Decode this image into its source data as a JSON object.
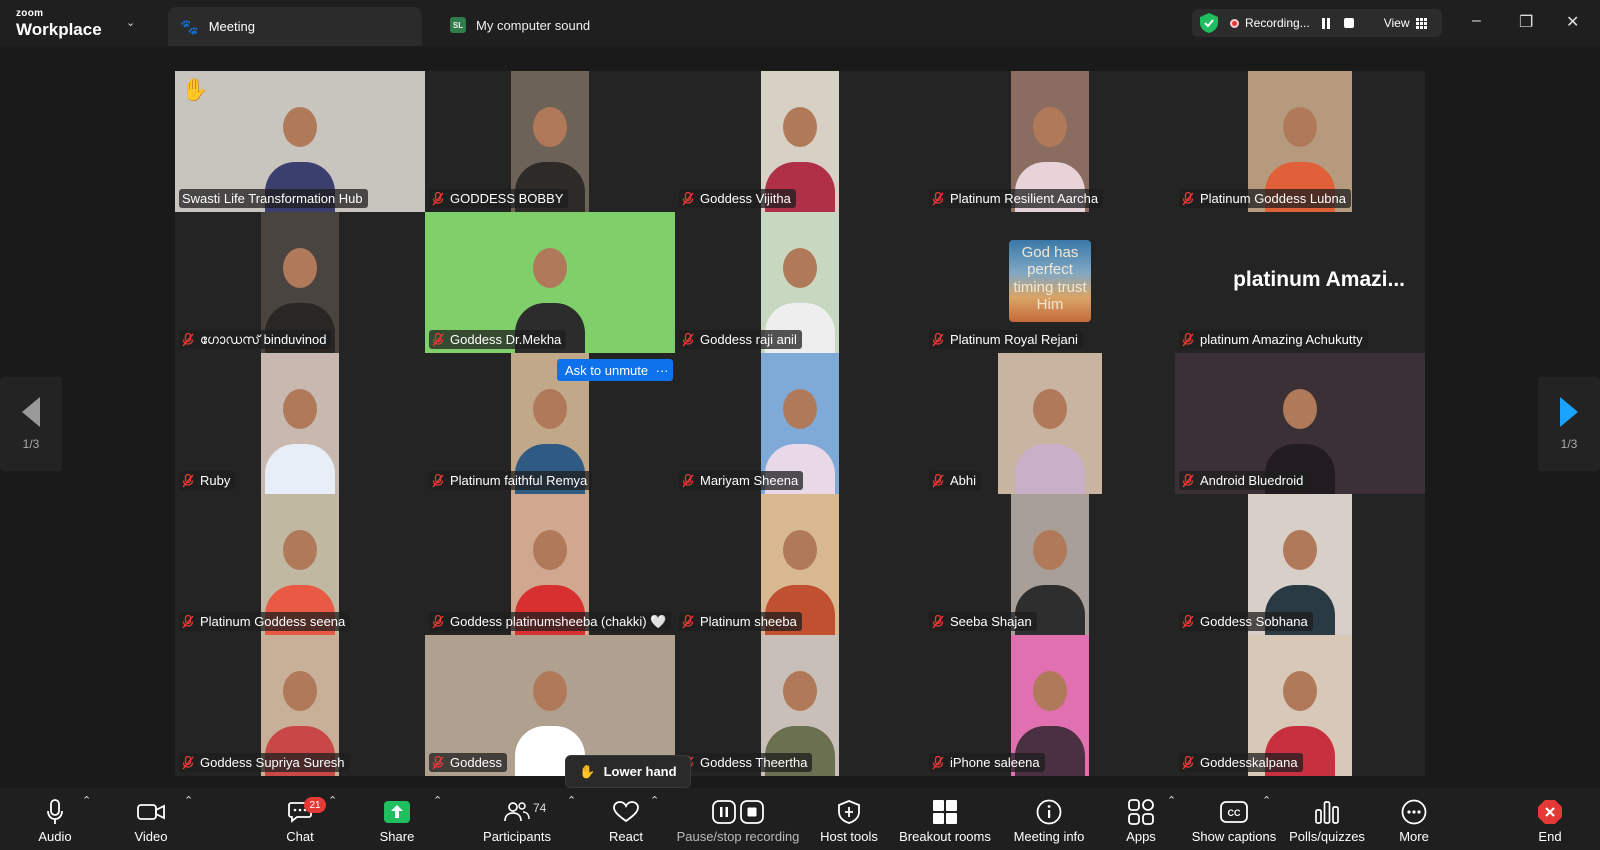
{
  "titlebar": {
    "brand_small": "zoom",
    "brand_large": "Workplace",
    "tab_meeting": "Meeting",
    "tab_sound_badge": "SL",
    "tab_sound": "My computer sound",
    "recording_label": "Recording...",
    "view_label": "View"
  },
  "overlay": {
    "ask_unmute": "Ask to unmute",
    "more": "···",
    "lower_hand": "Lower hand",
    "page_left": "1/3",
    "page_right": "1/3"
  },
  "participants": [
    {
      "name": "Swasti Life Transformation Hub",
      "muted": false,
      "active": true,
      "hand": true
    },
    {
      "name": "GODDESS BOBBY",
      "muted": true
    },
    {
      "name": "Goddess Vijitha",
      "muted": true
    },
    {
      "name": "Platinum Resilient Aarcha",
      "muted": true
    },
    {
      "name": "Platinum Goddess Lubna",
      "muted": true
    },
    {
      "name": "ഗോഡസ് binduvinod",
      "muted": true
    },
    {
      "name": "Goddess Dr.Mekha",
      "muted": true
    },
    {
      "name": "Goddess raji anil",
      "muted": true
    },
    {
      "name": "Platinum Royal Rejani",
      "muted": true,
      "image_text": "God has perfect timing trust Him"
    },
    {
      "name": "platinum Amazing Achukutty",
      "muted": true,
      "avatar_text": "platinum  Amazi..."
    },
    {
      "name": "Ruby",
      "muted": true
    },
    {
      "name": "Platinum faithful Remya",
      "muted": true
    },
    {
      "name": "Mariyam Sheena",
      "muted": true
    },
    {
      "name": "Abhi",
      "muted": true
    },
    {
      "name": "Android Bluedroid",
      "muted": true
    },
    {
      "name": "Platinum  Goddess seena",
      "muted": true
    },
    {
      "name": "Goddess  platinumsheeba (chakki) 🤍",
      "muted": true
    },
    {
      "name": "Platinum sheeba",
      "muted": true
    },
    {
      "name": "Seeba Shajan",
      "muted": true
    },
    {
      "name": "Goddess Sobhana",
      "muted": true
    },
    {
      "name": "Goddess Supriya Suresh",
      "muted": true
    },
    {
      "name": "Goddess",
      "muted": true
    },
    {
      "name": "Goddess Theertha",
      "muted": true
    },
    {
      "name": "iPhone saleena",
      "muted": true
    },
    {
      "name": "Goddesskalpana",
      "muted": true
    }
  ],
  "toolbar": {
    "audio": "Audio",
    "video": "Video",
    "chat": "Chat",
    "chat_badge": "21",
    "share": "Share",
    "participants": "Participants",
    "participants_count": "74",
    "react": "React",
    "pause_recording": "Pause/stop recording",
    "host_tools": "Host tools",
    "breakout": "Breakout rooms",
    "meeting_info": "Meeting info",
    "apps": "Apps",
    "captions": "Show captions",
    "polls": "Polls/quizzes",
    "more": "More",
    "end": "End"
  },
  "colors": {
    "active_speaker": "#2de37a",
    "accent_blue": "#0e72ed",
    "end_red": "#e53935",
    "share_green": "#1fbf5f"
  }
}
